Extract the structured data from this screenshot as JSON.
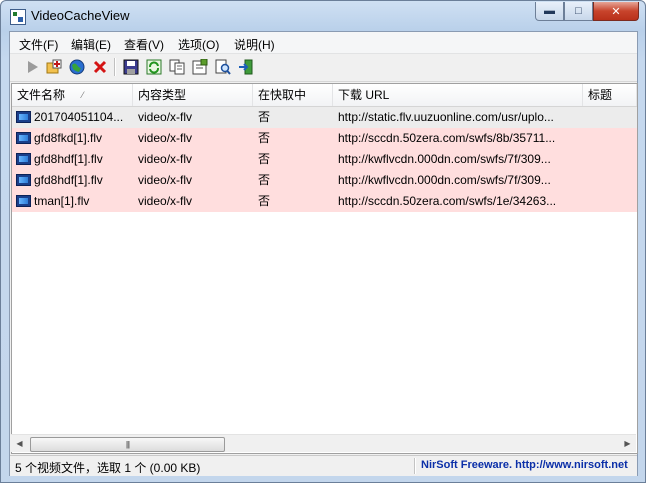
{
  "window": {
    "title": "VideoCacheView"
  },
  "menu": [
    "文件(F)",
    "编辑(E)",
    "查看(V)",
    "选项(O)",
    "说明(H)"
  ],
  "toolbar": [
    "play-icon",
    "add-folder-icon",
    "globe-icon",
    "delete-icon",
    "save-icon",
    "refresh-icon",
    "copy-icon",
    "properties-icon",
    "find-icon",
    "exit-icon"
  ],
  "columns": [
    "文件名称",
    "内容类型",
    "在快取中",
    "下载 URL",
    "标题"
  ],
  "rows": [
    {
      "name": "201704051104...",
      "type": "video/x-flv",
      "cached": "否",
      "url": "http://static.flv.uuzuonline.com/usr/uplo..."
    },
    {
      "name": "gfd8fkd[1].flv",
      "type": "video/x-flv",
      "cached": "否",
      "url": "http://sccdn.50zera.com/swfs/8b/35711..."
    },
    {
      "name": "gfd8hdf[1].flv",
      "type": "video/x-flv",
      "cached": "否",
      "url": "http://kwflvcdn.000dn.com/swfs/7f/309..."
    },
    {
      "name": "gfd8hdf[1].flv",
      "type": "video/x-flv",
      "cached": "否",
      "url": "http://kwflvcdn.000dn.com/swfs/7f/309..."
    },
    {
      "name": "tman[1].flv",
      "type": "video/x-flv",
      "cached": "否",
      "url": "http://sccdn.50zera.com/swfs/1e/34263..."
    }
  ],
  "colors": {
    "selected_row": "#ececec",
    "highlight_row": "#ffdede",
    "link": "#0b2fa8"
  },
  "status": {
    "summary": "5 个视频文件，选取 1 个 (0.00 KB)",
    "credit": "NirSoft Freeware.  http://www.nirsoft.net"
  }
}
